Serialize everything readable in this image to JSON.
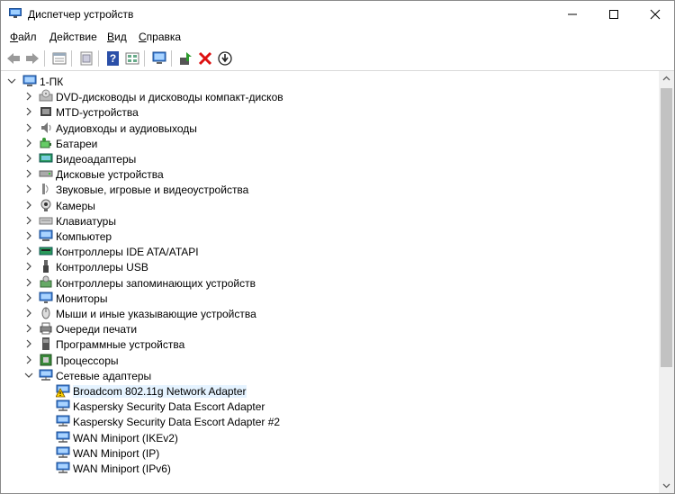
{
  "window": {
    "title": "Диспетчер устройств"
  },
  "menu": [
    {
      "accel": "Ф",
      "rest": "айл"
    },
    {
      "accel": "Д",
      "rest": "ействие"
    },
    {
      "accel": "В",
      "rest": "ид"
    },
    {
      "accel": "С",
      "rest": "правка"
    }
  ],
  "toolbar": [
    "back-icon",
    "forward-icon",
    "properties-icon",
    "help-sheet-icon",
    "help-icon",
    "show-hidden-icon",
    "monitor-icon",
    "update-driver-icon",
    "uninstall-icon",
    "download-icon"
  ],
  "tree": {
    "root": "1-ПК",
    "categories": [
      {
        "label": "DVD-дисководы и дисководы компакт-дисков",
        "icon": "dvd-icon"
      },
      {
        "label": "MTD-устройства",
        "icon": "mtd-icon"
      },
      {
        "label": "Аудиовходы и аудиовыходы",
        "icon": "audio-io-icon"
      },
      {
        "label": "Батареи",
        "icon": "battery-icon"
      },
      {
        "label": "Видеоадаптеры",
        "icon": "display-adapter-icon"
      },
      {
        "label": "Дисковые устройства",
        "icon": "disk-icon"
      },
      {
        "label": "Звуковые, игровые и видеоустройства",
        "icon": "sound-icon"
      },
      {
        "label": "Камеры",
        "icon": "camera-icon"
      },
      {
        "label": "Клавиатуры",
        "icon": "keyboard-icon"
      },
      {
        "label": "Компьютер",
        "icon": "computer-icon"
      },
      {
        "label": "Контроллеры IDE ATA/ATAPI",
        "icon": "ide-icon"
      },
      {
        "label": "Контроллеры USB",
        "icon": "usb-icon"
      },
      {
        "label": "Контроллеры запоминающих устройств",
        "icon": "storage-icon"
      },
      {
        "label": "Мониторы",
        "icon": "monitor-icon"
      },
      {
        "label": "Мыши и иные указывающие устройства",
        "icon": "mouse-icon"
      },
      {
        "label": "Очереди печати",
        "icon": "printer-icon"
      },
      {
        "label": "Программные устройства",
        "icon": "software-device-icon"
      },
      {
        "label": "Процессоры",
        "icon": "cpu-icon"
      },
      {
        "label": "Сетевые адаптеры",
        "icon": "network-icon",
        "expanded": true
      }
    ],
    "network_children": [
      {
        "label": "Broadcom 802.11g Network Adapter",
        "icon": "network-warning-icon",
        "selected": true
      },
      {
        "label": "Kaspersky Security Data Escort Adapter",
        "icon": "network-icon"
      },
      {
        "label": "Kaspersky Security Data Escort Adapter #2",
        "icon": "network-icon"
      },
      {
        "label": "WAN Miniport (IKEv2)",
        "icon": "network-icon"
      },
      {
        "label": "WAN Miniport (IP)",
        "icon": "network-icon"
      },
      {
        "label": "WAN Miniport (IPv6)",
        "icon": "network-icon"
      }
    ]
  }
}
